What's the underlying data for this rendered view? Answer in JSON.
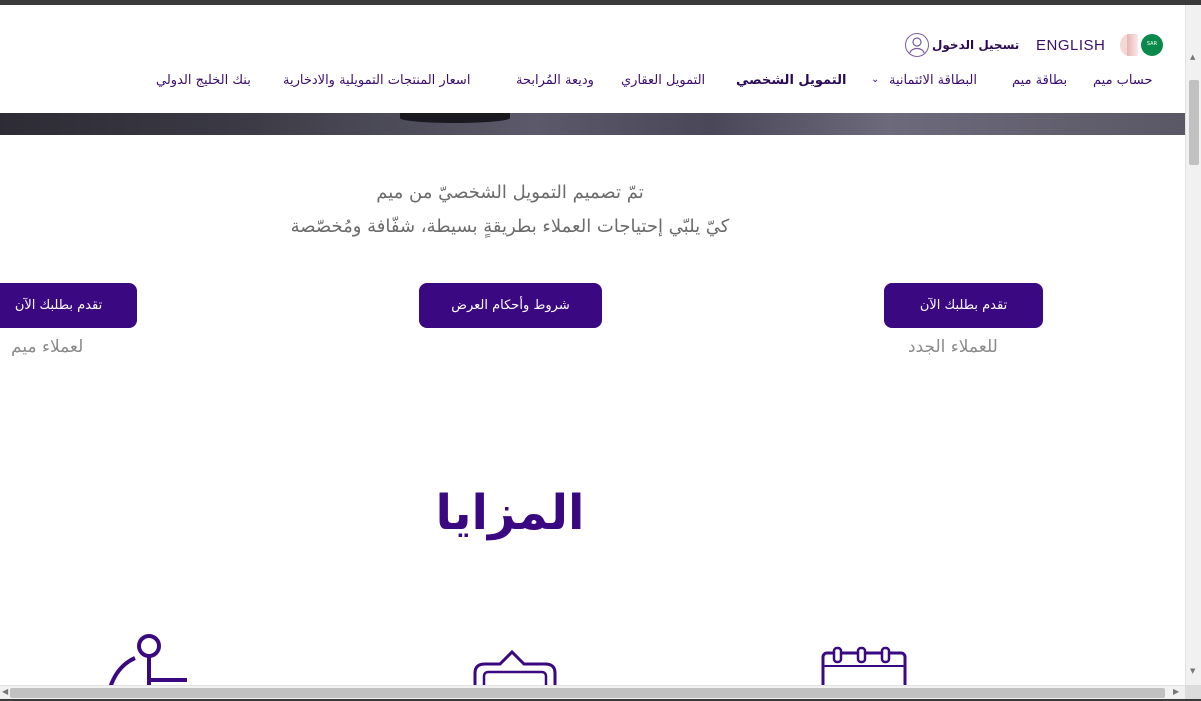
{
  "header": {
    "lang_label": "ENGLISH",
    "login_label": "تسجيل الدخول",
    "sa_flag_text": "SAR"
  },
  "nav": {
    "items": [
      {
        "label": "حساب ميم"
      },
      {
        "label": "بطاقة ميم"
      },
      {
        "label": "البطاقة الائتمانية"
      },
      {
        "label": "التمويل الشخصي"
      },
      {
        "label": "التمويل العقاري"
      },
      {
        "label": "وديعة المُرابحة"
      },
      {
        "label": "اسعار المنتجات التمويلية والادخارية"
      },
      {
        "label": "بنك الخليج الدولي"
      }
    ]
  },
  "intro": {
    "line1": "تمّ تصميم التمويل الشخصيّ من ميم",
    "line2": "كيّ يلبّي إحتياجات العملاء بطريقةٍ بسيطة، شفّافة ومُخصّصة"
  },
  "actions": {
    "apply_new_label": "تقدم بطلبك الآن",
    "apply_new_sub": "للعملاء الجدد",
    "terms_label": "شروط وأحكام العرض",
    "apply_meem_label": "تقدم بطلبك الآن",
    "apply_meem_sub": "لعملاء ميم"
  },
  "features": {
    "title": "المزايا",
    "icons": [
      "calendar-icon",
      "money-sar-icon",
      "anchor-icon"
    ]
  },
  "colors": {
    "brand": "#3a0880",
    "nav_text": "#3a0d6b",
    "muted_text": "#6b6b6b"
  }
}
